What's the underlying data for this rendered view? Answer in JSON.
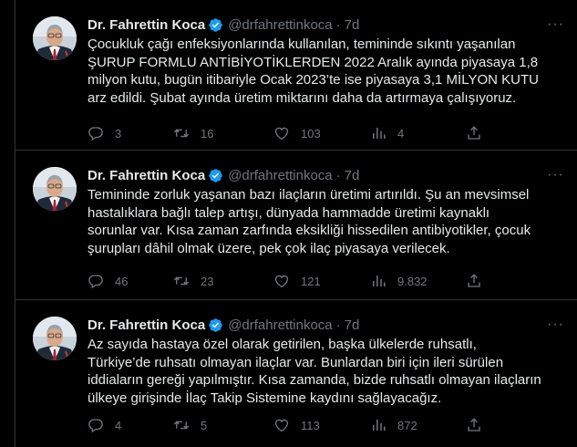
{
  "tweets": [
    {
      "author": "Dr. Fahrettin Koca",
      "handle": "@drfahrettinkoca",
      "separator": "·",
      "time": "7d",
      "text": "Çocukluk çağı enfeksiyonlarında kullanılan, temininde sıkıntı yaşanılan\nŞURUP FORMLU ANTİBİYOTİKLERDEN 2022 Aralık ayında piyasaya 1,8\nmilyon kutu, bugün itibariyle Ocak 2023’te ise piyasaya 3,1 MİLYON KUTU\narz edildi. Şubat ayında üretim miktarını daha da artırmaya çalışıyoruz.",
      "replies": "3",
      "retweets": "16",
      "likes": "103",
      "views": "4"
    },
    {
      "author": "Dr. Fahrettin Koca",
      "handle": "@drfahrettinkoca",
      "separator": "·",
      "time": "7d",
      "text": "Temininde zorluk yaşanan bazı ilaçların üretimi artırıldı. Şu an mevsimsel\nhastalıklara bağlı talep artışı, dünyada hammadde üretimi kaynaklı\nsorunlar var. Kısa zaman zarfında eksikliği hissedilen antibiyotikler, çocuk\nşurupları dâhil olmak üzere, pek çok ilaç piyasaya verilecek.",
      "replies": "46",
      "retweets": "23",
      "likes": "121",
      "views": "9.832"
    },
    {
      "author": "Dr. Fahrettin Koca",
      "handle": "@drfahrettinkoca",
      "separator": "·",
      "time": "7d",
      "text": "Az sayıda hastaya özel olarak getirilen, başka ülkelerde ruhsatlı,\nTürkiye’de ruhsatı olmayan ilaçlar var. Bunlardan biri için ileri sürülen\niddiaların gereği yapılmıştır. Kısa zamanda, bizde ruhsatlı olmayan ilaçların\nülkeye girişinde İlaç Takip Sistemine kaydını sağlayacağız.",
      "replies": "4",
      "retweets": "5",
      "likes": "113",
      "views": "872"
    }
  ],
  "colors": {
    "background": "#000000",
    "text": "#e7e9ea",
    "muted": "#71767b",
    "divider": "#2f3336",
    "verified": "#1d9bf0"
  }
}
